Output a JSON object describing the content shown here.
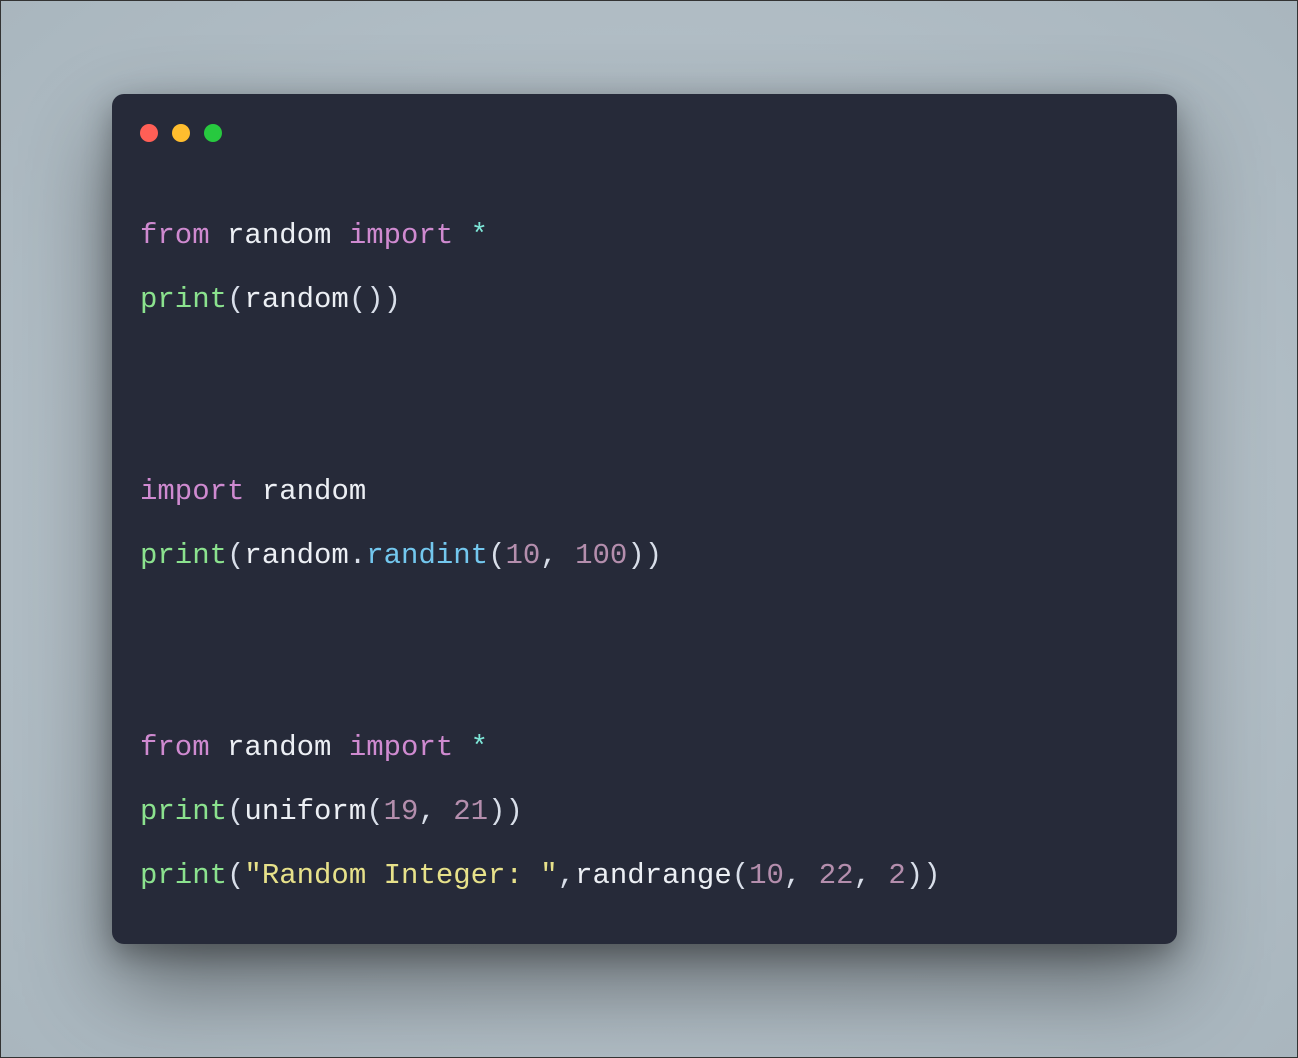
{
  "code": {
    "lines": [
      [
        {
          "t": "from ",
          "c": "kw"
        },
        {
          "t": "random ",
          "c": "id"
        },
        {
          "t": "import ",
          "c": "kw"
        },
        {
          "t": "*",
          "c": "op"
        }
      ],
      [
        {
          "t": "print",
          "c": "fn"
        },
        {
          "t": "(",
          "c": "pun"
        },
        {
          "t": "random",
          "c": "id"
        },
        {
          "t": "())",
          "c": "pun"
        }
      ],
      [],
      [],
      [
        {
          "t": "import ",
          "c": "kw"
        },
        {
          "t": "random",
          "c": "id"
        }
      ],
      [
        {
          "t": "print",
          "c": "fn"
        },
        {
          "t": "(",
          "c": "pun"
        },
        {
          "t": "random",
          "c": "id"
        },
        {
          "t": ".",
          "c": "pun"
        },
        {
          "t": "randint",
          "c": "call"
        },
        {
          "t": "(",
          "c": "pun"
        },
        {
          "t": "10",
          "c": "num"
        },
        {
          "t": ", ",
          "c": "pun"
        },
        {
          "t": "100",
          "c": "num"
        },
        {
          "t": "))",
          "c": "pun"
        }
      ],
      [],
      [],
      [
        {
          "t": "from ",
          "c": "kw"
        },
        {
          "t": "random ",
          "c": "id"
        },
        {
          "t": "import ",
          "c": "kw"
        },
        {
          "t": "*",
          "c": "op"
        }
      ],
      [
        {
          "t": "print",
          "c": "fn"
        },
        {
          "t": "(",
          "c": "pun"
        },
        {
          "t": "uniform",
          "c": "id"
        },
        {
          "t": "(",
          "c": "pun"
        },
        {
          "t": "19",
          "c": "num"
        },
        {
          "t": ", ",
          "c": "pun"
        },
        {
          "t": "21",
          "c": "num"
        },
        {
          "t": "))",
          "c": "pun"
        }
      ],
      [
        {
          "t": "print",
          "c": "fn"
        },
        {
          "t": "(",
          "c": "pun"
        },
        {
          "t": "\"Random Integer: \"",
          "c": "str"
        },
        {
          "t": ",",
          "c": "pun"
        },
        {
          "t": "randrange",
          "c": "id"
        },
        {
          "t": "(",
          "c": "pun"
        },
        {
          "t": "10",
          "c": "num"
        },
        {
          "t": ", ",
          "c": "pun"
        },
        {
          "t": "22",
          "c": "num"
        },
        {
          "t": ", ",
          "c": "pun"
        },
        {
          "t": "2",
          "c": "num"
        },
        {
          "t": "))",
          "c": "pun"
        }
      ]
    ]
  }
}
